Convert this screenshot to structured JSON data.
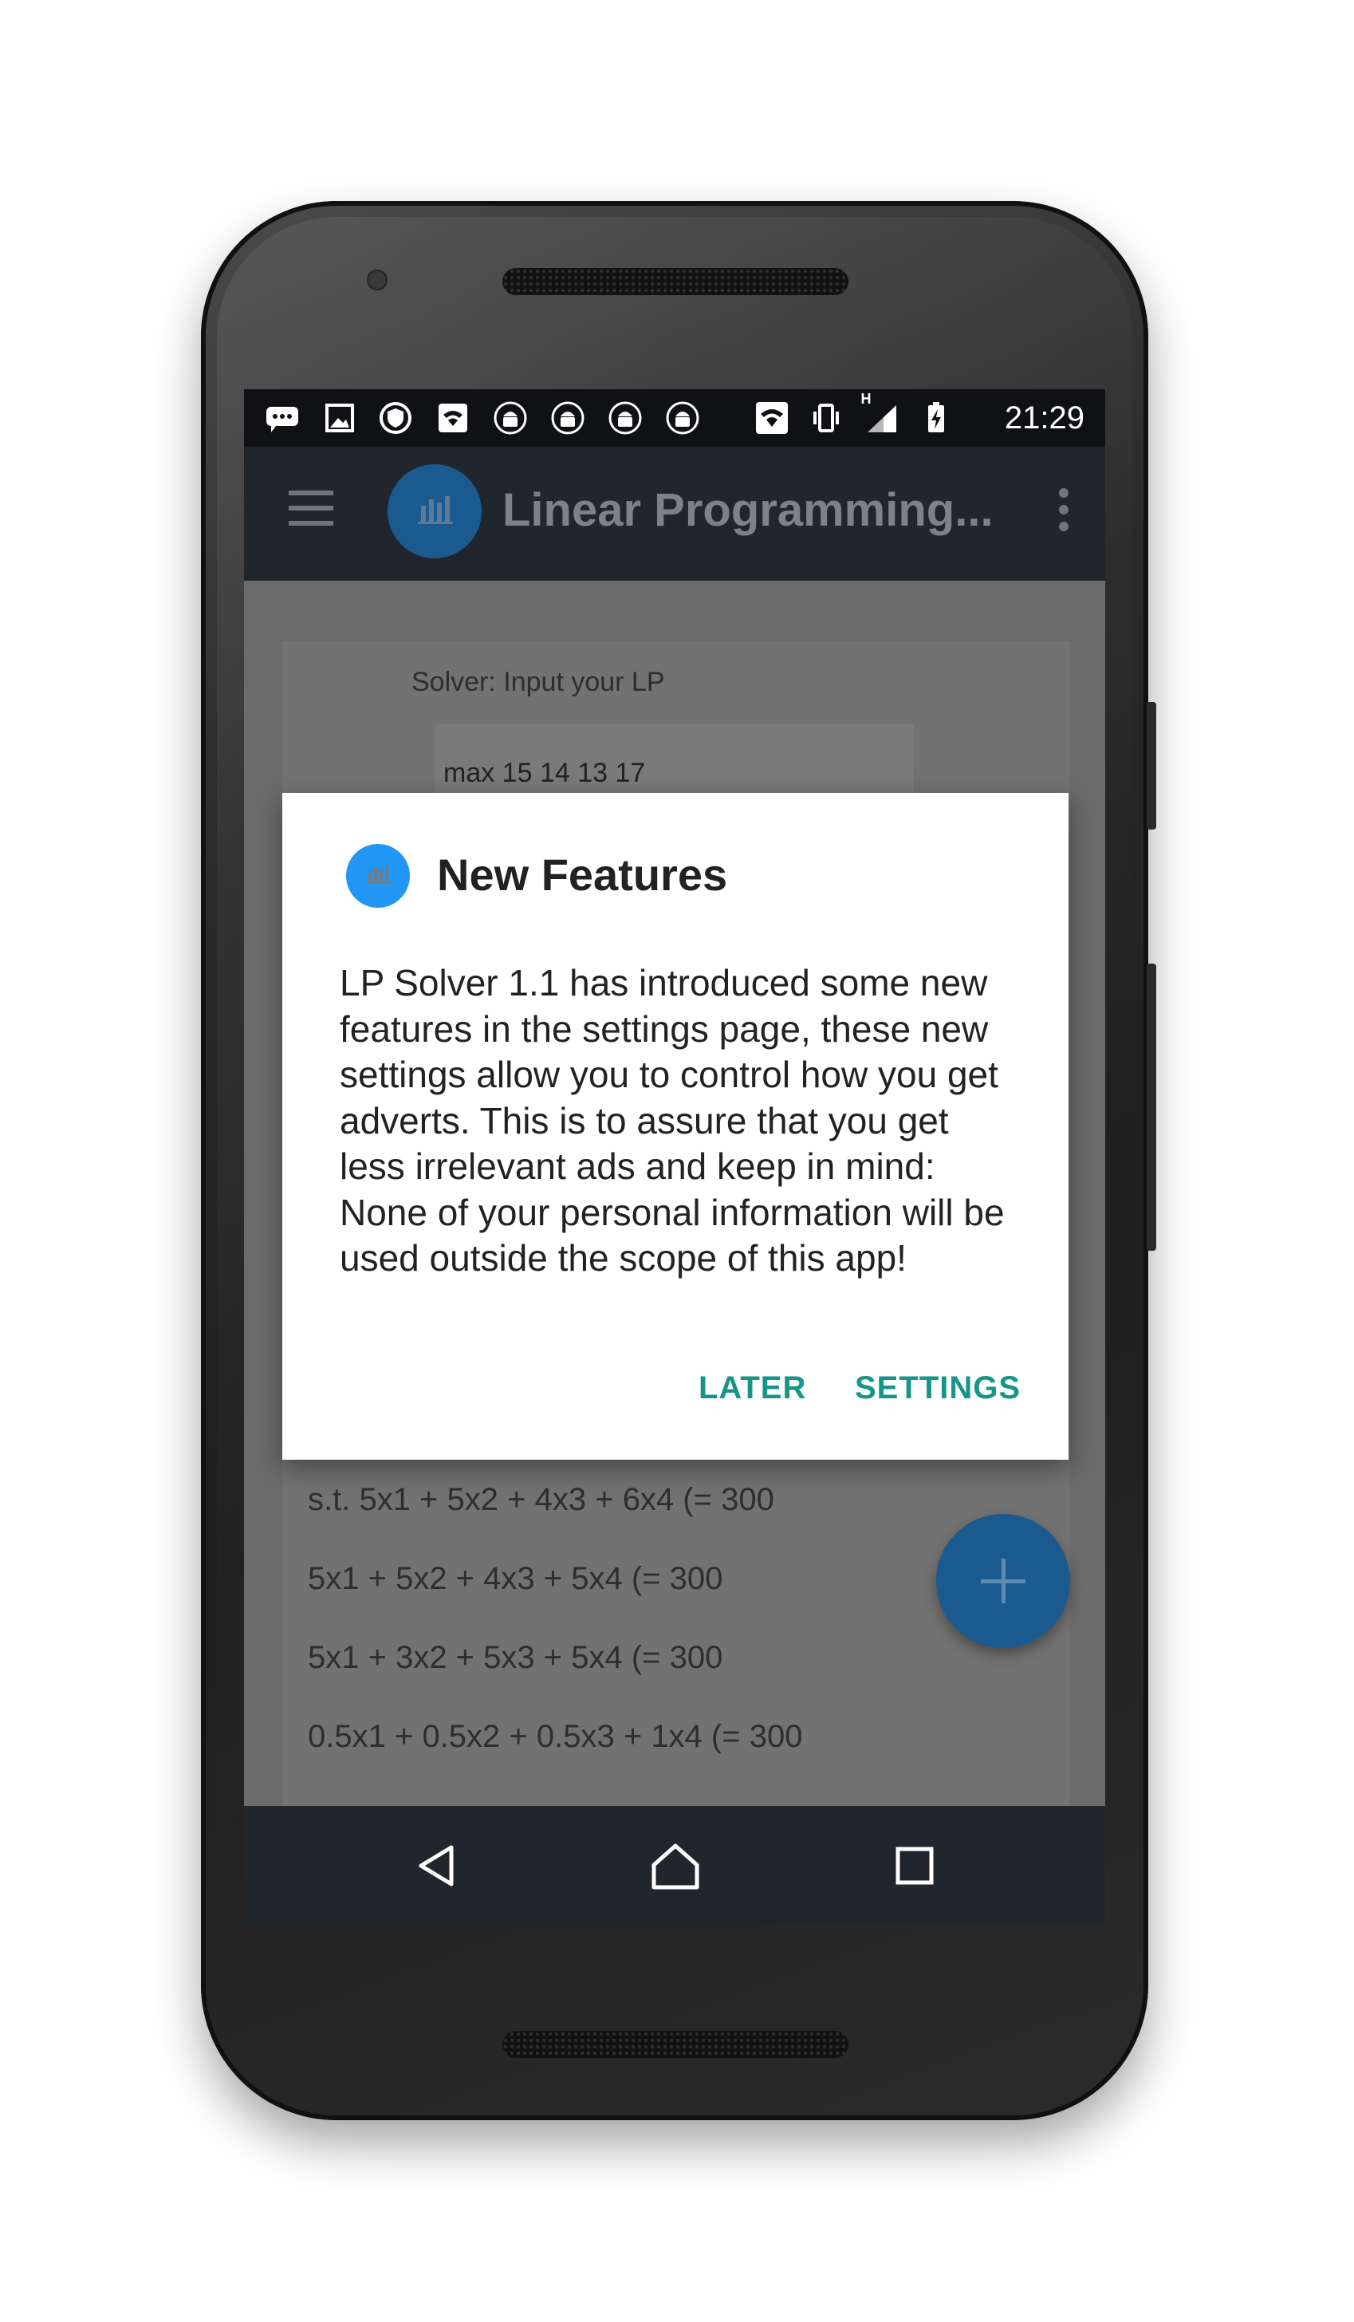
{
  "status_bar": {
    "time": "21:29",
    "icons": [
      "message-icon",
      "image-icon",
      "shield-icon",
      "wifi-box-icon",
      "android-icon",
      "android-icon",
      "android-icon",
      "android-icon",
      "wifi-icon",
      "vibrate-icon",
      "signal-icon",
      "battery-charging-icon"
    ],
    "network_label": "H"
  },
  "app_bar": {
    "title": "Linear Programming..."
  },
  "content": {
    "solver_label": "Solver: Input your LP",
    "objective": "max 15 14 13 17",
    "constraints": [
      "s.t. 5x1 + 5x2 + 4x3 + 6x4 (= 300",
      "5x1 + 5x2 + 4x3 + 5x4 (= 300",
      "5x1 + 3x2 + 5x3 + 5x4 (= 300",
      "0.5x1 + 0.5x2 + 0.5x3 + 1x4 (= 300"
    ],
    "fab_icon": "plus-icon"
  },
  "dialog": {
    "title": "New Features",
    "body": "LP Solver 1.1 has introduced some new features in the settings page, these new settings allow you to control how you get adverts. This is to assure that you get less irrelevant ads and keep in mind: None of your personal information will be used outside the scope of this app!",
    "later_label": "LATER",
    "settings_label": "SETTINGS"
  },
  "colors": {
    "accent": "#159688",
    "primary": "#2196f3",
    "appbar": "#1f262d"
  }
}
